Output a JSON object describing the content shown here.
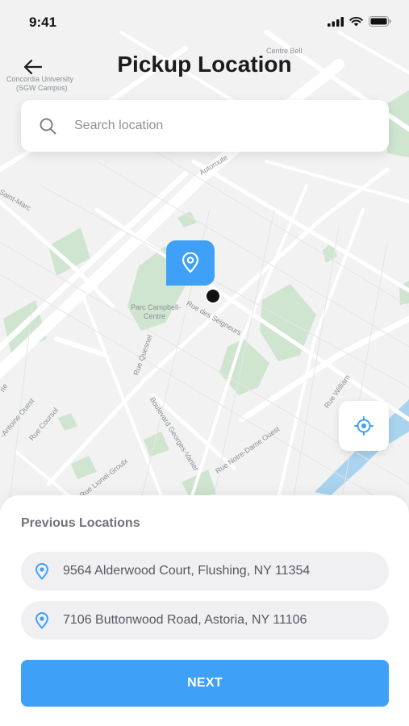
{
  "status_bar": {
    "time": "9:41"
  },
  "header": {
    "title": "Pickup Location",
    "back_icon": "arrow-left-icon"
  },
  "search": {
    "placeholder": "Search location",
    "value": "",
    "icon": "search-icon"
  },
  "map": {
    "labels": {
      "university": "Concordia University",
      "campus": "(SGW Campus)",
      "centre_bell": "Centre Bell",
      "autoroute": "Autoroute",
      "saint_marc": "Saint-Marc",
      "parc_campbell": "Parc Campbell-",
      "centre": "Centre",
      "rue_des_seigneurs": "Rue des Seigneurs",
      "rue_quesnel": "Rue Quesnel",
      "boulevard_georges_vanier": "Boulevard Georges-Vanier",
      "rue_notre_dame_ouest": "Rue Notre-Dame Ouest",
      "rue_william": "Rue William",
      "antoine_ouest": "-Antoine Ouest",
      "rue_coursol": "Rue Coursol",
      "rue_lionel_groulx": "Rue Lionel-Groulx",
      "rie": "rie"
    },
    "colors": {
      "background": "#f1f2f1",
      "park": "#cfe5d0",
      "water": "#a9d3ee",
      "road": "#ffffff"
    }
  },
  "pin": {
    "icon": "location-pin-icon",
    "color": "#3ea0f7"
  },
  "locate_button": {
    "icon": "crosshair-icon"
  },
  "previous_locations": {
    "title": "Previous Locations",
    "items": [
      {
        "address": "9564 Alderwood Court, Flushing, NY 11354",
        "icon": "location-pin-icon"
      },
      {
        "address": "7106 Buttonwood Road, Astoria, NY 11106",
        "icon": "location-pin-icon"
      }
    ]
  },
  "next_button": {
    "label": "NEXT",
    "color": "#3ea0f7"
  }
}
